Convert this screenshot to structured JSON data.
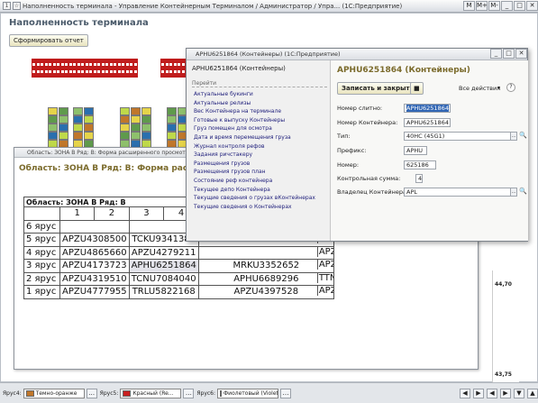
{
  "titlebar": {
    "title": "Наполненность терминала - Управление Контейнерным Терминалом / Администратор / Упра...  (1С:Предприятие)",
    "buttons": [
      "M",
      "M+",
      "M-"
    ]
  },
  "main": {
    "title": "Наполненность терминала",
    "report_button": "Сформировать отчет",
    "right_values": [
      "44,70",
      "43,75"
    ]
  },
  "win2": {
    "title": "Область: ЗОНА В Ряд: В: Форма расширенного просмотра",
    "heading": "Область: ЗОНА В Ряд: В: Форма расш",
    "table_title": "Область: ЗОНА В Ряд: В",
    "columns": [
      "1",
      "2",
      "3",
      "4"
    ],
    "rows": [
      {
        "label": "6 ярус",
        "cells": [
          "",
          "",
          "",
          ""
        ]
      },
      {
        "label": "5 ярус",
        "cells": [
          "APZU4308500",
          "",
          "TCKU9341385",
          ""
        ]
      },
      {
        "label": "4 ярус",
        "cells": [
          "APZU4865660",
          "",
          "APZU4279211",
          ""
        ]
      },
      {
        "label": "3 ярус",
        "cells": [
          "APZU4173723",
          "",
          "APHU6251864",
          "MRKU3352652"
        ]
      },
      {
        "label": "2 ярус",
        "cells": [
          "APZU4319510",
          "",
          "TCNU7084040",
          "APHU6689296"
        ]
      },
      {
        "label": "1 ярус",
        "cells": [
          "APZU4777955",
          "",
          "TRLU5822168",
          "APZU4397528"
        ]
      }
    ],
    "edge_cells": [
      "APZ",
      "APZ",
      "APZ",
      "TTN",
      "APZ"
    ]
  },
  "win3": {
    "title": "APHU6251864 (Контейнеры)  (1С:Предприятие)",
    "nav_header": "APHU6251864 (Контейнеры)",
    "nav_go": "Перейти",
    "nav_links": [
      "Актуальные букинги",
      "Актуальные релизы",
      "Вес Контейнера на терминале",
      "Готовые к выпуску Контейнеры",
      "Груз помещен для осмотра",
      "Дата и время перемещения груза",
      "Журнал контроля рефов",
      "Задания ричстакеру",
      "Размещения грузов",
      "Размещения грузов план",
      "Состояние реф контейнера",
      "Текущее депо Контейнера",
      "Текущие сведения о грузах вКонтейнерах",
      "Текущие сведения о Контейнерах"
    ],
    "form_heading": "APHU6251864 (Контейнеры)",
    "save_button": "Записать и закрыть",
    "all_actions": "Все действия",
    "fields": [
      {
        "label": "Номер слитно:",
        "value": "APHU6251864"
      },
      {
        "label": "Номер Контейнера:",
        "value": "APHU6251864"
      },
      {
        "label": "Тип:",
        "value": "40HC (45G1)"
      },
      {
        "label": "Префикс:",
        "value": "APHU"
      },
      {
        "label": "Номер:",
        "value": "625186"
      },
      {
        "label": "Контрольная сумма:",
        "value": "4"
      },
      {
        "label": "Владелец Контейнера:",
        "value": "APL"
      }
    ]
  },
  "bottom": {
    "legend": [
      {
        "prefix": "Ярус4:",
        "label": "Темно-оранже",
        "color": "#c0772b"
      },
      {
        "prefix": "Ярус5:",
        "label": "Красный (Re...",
        "color": "#c82020"
      },
      {
        "prefix": "Ярус6:",
        "label": "Фиолетовый (Violet",
        "color": "#e7a8e6"
      }
    ]
  }
}
